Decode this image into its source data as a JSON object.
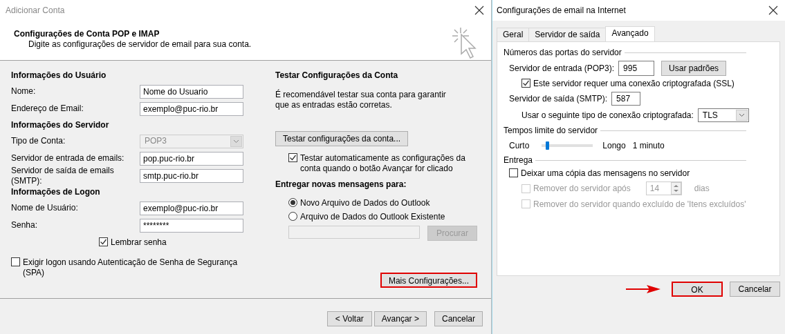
{
  "account_window": {
    "title": "Adicionar Conta",
    "header_title": "Configurações de Conta POP e IMAP",
    "header_subtitle": "Digite as configurações de servidor de email para sua conta.",
    "sections": [
      {
        "heading": "Informações do Usuário",
        "fields": [
          {
            "label": "Nome:",
            "value": "Nome do Usuario",
            "kind": "text",
            "disabled": false
          },
          {
            "label": "Endereço de Email:",
            "value": "exemplo@puc-rio.br",
            "kind": "text",
            "disabled": false
          }
        ]
      },
      {
        "heading": "Informações do Servidor",
        "fields": [
          {
            "label": "Tipo de Conta:",
            "value": "POP3",
            "kind": "select",
            "disabled": true
          },
          {
            "label": "Servidor de entrada de emails:",
            "value": "pop.puc-rio.br",
            "kind": "text",
            "disabled": false
          },
          {
            "label": "Servidor de saída de emails (SMTP):",
            "value": "smtp.puc-rio.br",
            "kind": "text",
            "disabled": false
          }
        ]
      },
      {
        "heading": "Informações de Logon",
        "fields": [
          {
            "label": "Nome de Usuário:",
            "value": "exemplo@puc-rio.br",
            "kind": "text",
            "disabled": false
          },
          {
            "label": "Senha:",
            "value": "********",
            "kind": "text",
            "disabled": false
          }
        ]
      }
    ],
    "remember_password": {
      "label": "Lembrar senha",
      "checked": true
    },
    "spa": {
      "label": "Exigir logon usando Autenticação de Senha de Segurança (SPA)",
      "checked": false
    },
    "test_heading": "Testar Configurações da Conta",
    "test_description": "É recomendável testar sua conta para garantir que as entradas estão corretas.",
    "test_button": "Testar configurações da conta...",
    "auto_test": {
      "label": "Testar automaticamente as configurações da conta quando o botão Avançar for clicado",
      "checked": true
    },
    "deliver_heading": "Entregar novas mensagens para:",
    "deliver_options": [
      {
        "label": "Novo Arquivo de Dados do Outlook",
        "selected": true
      },
      {
        "label": "Arquivo de Dados do Outlook Existente",
        "selected": false
      }
    ],
    "browse_button": {
      "label": "Procurar",
      "disabled": true
    },
    "more_settings_button": {
      "label": "Mais Configurações...",
      "highlighted": true
    },
    "footer_buttons": [
      {
        "label": "< Voltar",
        "highlighted": false
      },
      {
        "label": "Avançar >",
        "highlighted": false
      },
      {
        "label": "Cancelar",
        "highlighted": false
      }
    ]
  },
  "internet_settings_window": {
    "title": "Configurações de email na Internet",
    "tabs": [
      {
        "label": "Geral",
        "selected": false
      },
      {
        "label": "Servidor de saída",
        "selected": false
      },
      {
        "label": "Avançado",
        "selected": true
      }
    ],
    "ports_heading": "Números das portas do servidor",
    "incoming": {
      "label": "Servidor de entrada (POP3):",
      "value": "995"
    },
    "use_defaults_button": "Usar padrões",
    "ssl": {
      "label": "Este servidor requer uma conexão criptografada (SSL)",
      "checked": true
    },
    "outgoing": {
      "label": "Servidor de saída (SMTP):",
      "value": "587"
    },
    "encryption": {
      "label": "Usar o seguinte tipo de conexão criptografada:",
      "value": "TLS"
    },
    "timeouts_heading": "Tempos limite do servidor",
    "timeout": {
      "min_label": "Curto",
      "max_label": "Longo",
      "level": 0.08,
      "reading": "1 minuto"
    },
    "delivery_heading": "Entrega",
    "leave_copy": {
      "label": "Deixar uma cópia das mensagens no servidor",
      "checked": false,
      "disabled": false
    },
    "remove_after": {
      "label": "Remover do servidor após",
      "checked": false,
      "disabled": true,
      "value": "14",
      "unit": "dias"
    },
    "remove_deleted": {
      "label": "Remover do servidor quando excluído de 'Itens excluídos'",
      "checked": false,
      "disabled": true
    },
    "buttons": [
      {
        "label": "OK",
        "highlighted": true
      },
      {
        "label": "Cancelar",
        "highlighted": false
      }
    ]
  }
}
